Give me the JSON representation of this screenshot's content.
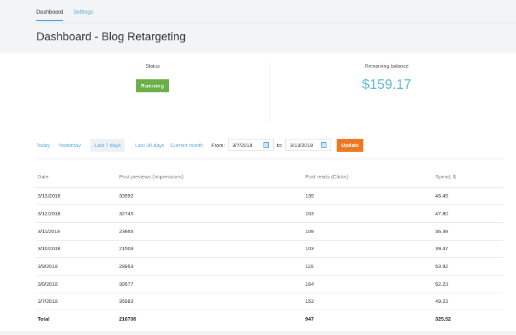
{
  "tabs": [
    {
      "label": "Dashboard",
      "active": true
    },
    {
      "label": "Settings",
      "active": false
    }
  ],
  "title": "Dashboard - Blog Retargeting",
  "status": {
    "label": "Status",
    "value": "Running",
    "color": "#6aaf47"
  },
  "balance": {
    "label": "Remaining balance",
    "value": "$159.17"
  },
  "filters": {
    "ranges": [
      "Today",
      "Yesterday",
      "Last 7 days",
      "Last 30 days",
      "Current month"
    ],
    "active": "Last 7 days",
    "from_label": "From:",
    "from": "3/7/2018",
    "to_label": "to:",
    "to": "3/13/2018",
    "update": "Update"
  },
  "table": {
    "headers": [
      "Date",
      "Post previews (Impressions)",
      "Post reads (Clicks)",
      "Spend, $"
    ],
    "rows": [
      [
        "3/13/2018",
        "33992",
        "139",
        "46.49"
      ],
      [
        "3/12/2018",
        "32745",
        "163",
        "47.80"
      ],
      [
        "3/11/2018",
        "23955",
        "109",
        "36.38"
      ],
      [
        "3/10/2018",
        "21503",
        "103",
        "39.47"
      ],
      [
        "3/9/2018",
        "28953",
        "116",
        "53.92"
      ],
      [
        "3/8/2018",
        "39577",
        "164",
        "52.23"
      ],
      [
        "3/7/2018",
        "35983",
        "153",
        "49.23"
      ]
    ],
    "total": [
      "Total",
      "216708",
      "947",
      "325.52"
    ]
  }
}
